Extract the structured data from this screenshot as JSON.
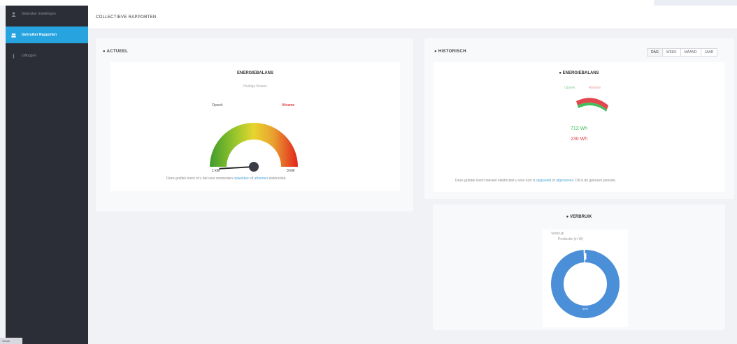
{
  "sidebar": {
    "items": [
      {
        "label": "Gebruiker Instellingen",
        "icon": "user-icon",
        "active": false
      },
      {
        "label": "Gebruiker Rapporten",
        "icon": "users-icon",
        "active": true
      },
      {
        "label": "Uitloggen",
        "icon": "logout-icon",
        "active": false
      }
    ],
    "footer": "Versie"
  },
  "header": {
    "breadcrumb": "COLLECTIEVE RAPPORTEN"
  },
  "actueel": {
    "title": "ACTUEEL",
    "gauge_title": "ENERGIEBALANS",
    "gauge_subtitle": "Huidige Balans",
    "label_left": "Opwek",
    "label_right": "Afname",
    "min_label": "1 kW",
    "max_label": "3 kW",
    "level": 0.04,
    "desc_pre": "Deze grafiek toont of u het voor momenten ",
    "desc_link1": "opwekken",
    "desc_mid": " of ",
    "desc_link2": "afnemen",
    "desc_post": " elektriciteit."
  },
  "historisch": {
    "title": "HISTORISCH",
    "tabs": [
      {
        "label": "DAG",
        "active": true
      },
      {
        "label": "WEEK",
        "active": false
      },
      {
        "label": "MAAND",
        "active": false
      },
      {
        "label": "JAAR",
        "active": false
      }
    ],
    "balans_title": "ENERGIEBALANS",
    "legend_green": "Opwek",
    "legend_red": "Afname",
    "value_green": "712 Wh",
    "value_red": "230 Wh",
    "desc_pre": "Deze grafiek toont hoeveel elektriciteit u voor kort is ",
    "desc_link1": "opgewekt",
    "desc_mid": " of ",
    "desc_link2": "afgenomen",
    "desc_post": ". Dit is de gekozen periode."
  },
  "verbruik": {
    "title": "VERBRUIK",
    "legend1": "Verbruik",
    "legend2": "Productie (in W)",
    "donut_fraction": 0.99,
    "donut_label": "99%",
    "colors": {
      "donut": "#4a8fd8",
      "ring_bg": "#ffffff"
    }
  },
  "colors": {
    "sidebar_bg": "#2b2e36",
    "accent": "#27a3e0",
    "green": "#3fbf5a",
    "red": "#e1474c"
  }
}
